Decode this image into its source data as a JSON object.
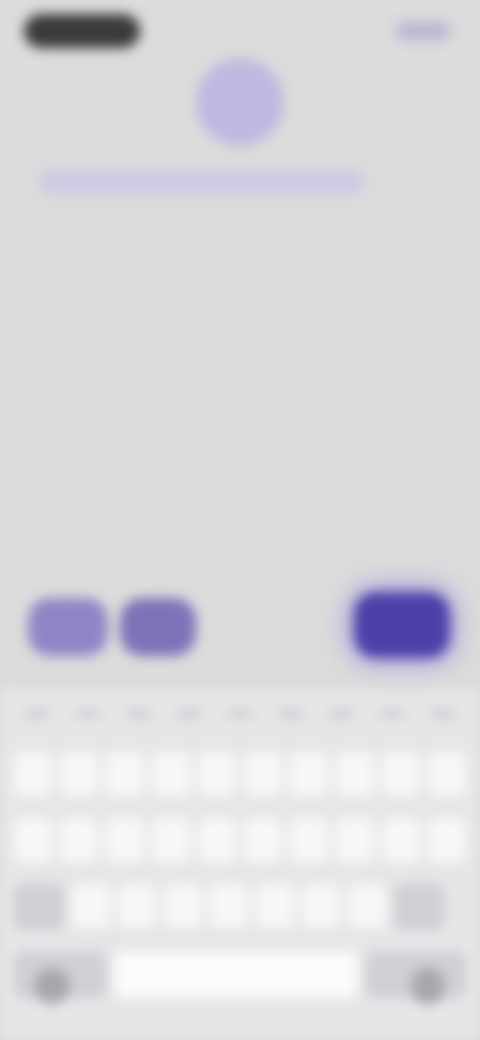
{
  "status_bar": {
    "time": "",
    "icons": "status-icons"
  },
  "header": {
    "avatar": "avatar",
    "title": ""
  },
  "actions": {
    "chip1": "",
    "chip2": "",
    "primary": ""
  },
  "keyboard": {
    "suggestions": [
      "",
      "",
      "",
      "",
      "",
      "",
      "",
      "",
      ""
    ]
  },
  "colors": {
    "primary": "#4b40a8",
    "chip": "#8f85c6",
    "background": "#dcdcdc"
  }
}
